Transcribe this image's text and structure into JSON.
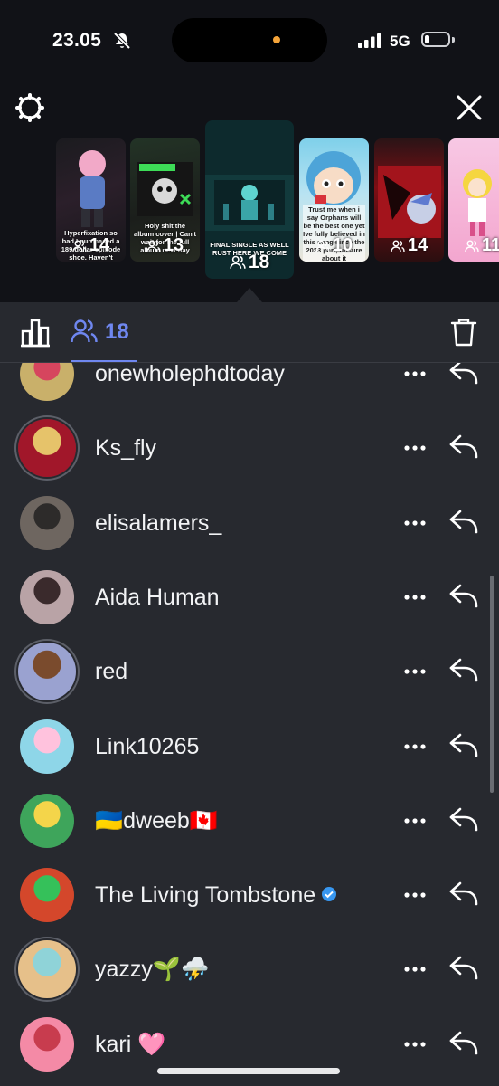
{
  "status_bar": {
    "time": "23.05",
    "network": "5G",
    "icons": [
      "bell-off-icon",
      "signal-icon",
      "battery-icon"
    ]
  },
  "header_icons": {
    "settings": "gear-icon",
    "close": "close-icon"
  },
  "stories": [
    {
      "caption": "Hyperfixation so bad I purchased a 189 dollar episode shoe. Haven't finished yet",
      "count": "14"
    },
    {
      "caption": "Holy shit the album cover | Can't wait for the full album next day",
      "count": "13"
    },
    {
      "caption": "FINAL SINGLE AS WELL RUST HERE WE COME",
      "count": "18"
    },
    {
      "caption": "Trust me when i say Orphans will be the best one yet Ive fully believed in this song since the 2023 part, unsure about it",
      "count": "10"
    },
    {
      "caption": "",
      "count": "14"
    },
    {
      "caption": "",
      "count": "11"
    }
  ],
  "sheet": {
    "insights_icon": "bar-chart-icon",
    "viewers_icon": "people-icon",
    "viewers_count": "18",
    "delete_icon": "trash-icon"
  },
  "viewers": [
    {
      "username": "onewholephdtoday",
      "avatar_colors": [
        "#c9b06a",
        "#d6455e"
      ]
    },
    {
      "username": "Ks_fly",
      "avatar_colors": [
        "#a1172a",
        "#e6c36a"
      ]
    },
    {
      "username": "elisalamers_",
      "avatar_colors": [
        "#6e6660",
        "#2d2b2a"
      ]
    },
    {
      "username": "Aida Human",
      "avatar_colors": [
        "#b9a3a6",
        "#3a2a2c"
      ]
    },
    {
      "username": "red",
      "avatar_colors": [
        "#9aa2d0",
        "#7a4b2d"
      ]
    },
    {
      "username": "Link10265",
      "avatar_colors": [
        "#8ed6e8",
        "#ffc2dd"
      ]
    },
    {
      "username": "🇺🇦dweeb🇨🇦",
      "avatar_colors": [
        "#3ea55b",
        "#f4d54a"
      ]
    },
    {
      "username": "The Living Tombstone",
      "avatar_colors": [
        "#d4472b",
        "#35c15a"
      ],
      "verified": true
    },
    {
      "username": "yazzy🌱⛈️",
      "avatar_colors": [
        "#e6c08a",
        "#8fd3d8"
      ]
    },
    {
      "username": "kari 🩷",
      "avatar_colors": [
        "#f48aa6",
        "#c83c4e"
      ]
    }
  ],
  "row_icons": {
    "more": "more-dots-icon",
    "reply": "reply-arrow-icon"
  }
}
